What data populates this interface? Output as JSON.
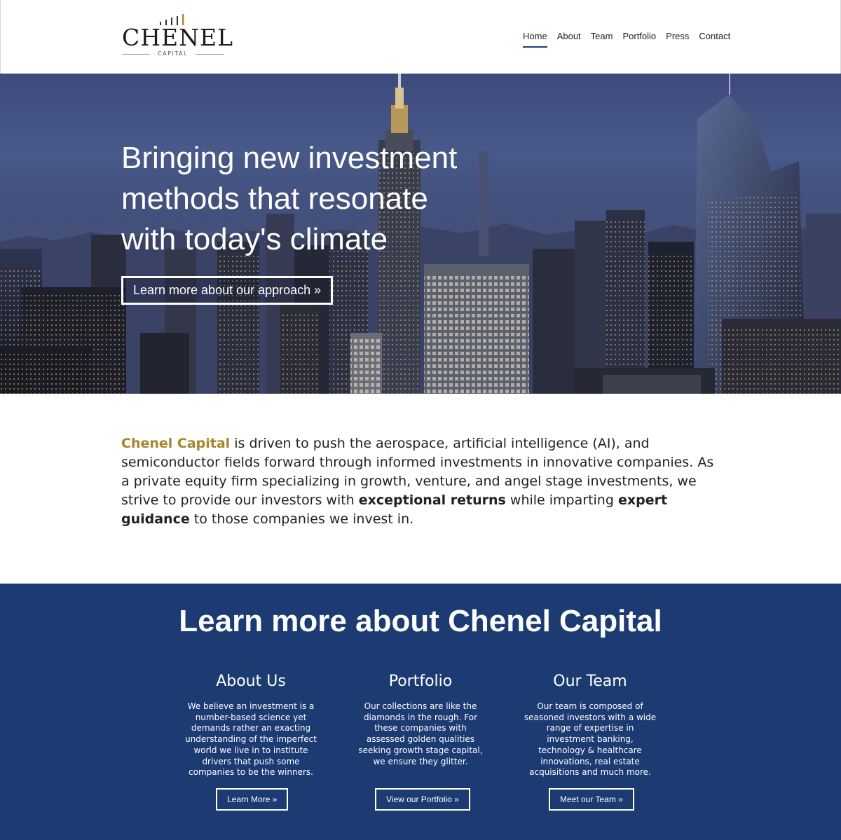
{
  "logo": {
    "word": "CHENEL",
    "sub": "CAPITAL"
  },
  "nav": {
    "items": [
      "Home",
      "About",
      "Team",
      "Portfolio",
      "Press",
      "Contact"
    ],
    "active": "Home"
  },
  "hero": {
    "title": "Bringing new investment methods that resonate with today's climate",
    "button": "Learn more about our approach »"
  },
  "intro": {
    "brand": "Chenel Capital",
    "text1": " is driven to push the aerospace, artificial intelligence (AI), and semiconductor fields forward through informed investments in innovative companies. As a private equity firm specializing in growth, venture, and angel stage investments, we strive to provide our investors with ",
    "strong1": "exceptional returns",
    "text2": " while imparting ",
    "strong2": "expert guidance",
    "text3": " to those companies we invest in."
  },
  "learn": {
    "title": "Learn more about Chenel Capital",
    "columns": [
      {
        "heading": "About Us",
        "body": "We believe an investment is a number-based science yet demands rather an exacting understanding of the imperfect world we live in to institute drivers that push some companies to be the winners.",
        "button": "Learn More »"
      },
      {
        "heading": "Portfolio",
        "body": "Our collections are like the diamonds in the rough. For these companies with assessed golden qualities seeking growth stage capital, we ensure they glitter.",
        "button": "View our Portfolio »"
      },
      {
        "heading": "Our Team",
        "body": "Our team is composed of seasoned investors with a wide range of expertise in investment banking, technology & healthcare innovations, real estate acquisitions and much more.",
        "button": "Meet our Team »"
      }
    ]
  },
  "colors": {
    "navy": "#1c3b73",
    "gold": "#a8852c",
    "nav_underline": "#1f3b73"
  }
}
